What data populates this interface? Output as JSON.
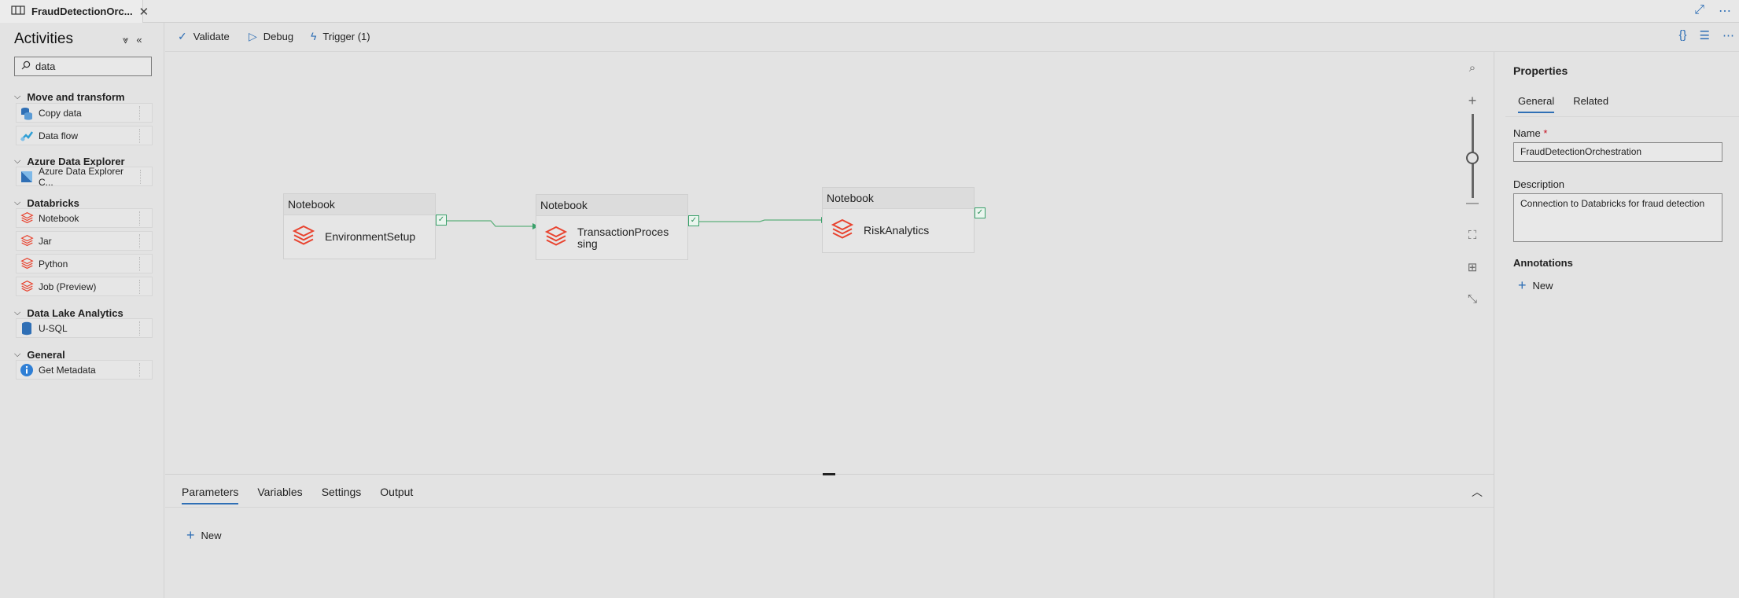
{
  "tab": {
    "title": "FraudDetectionOrc..."
  },
  "activities": {
    "header": "Activities",
    "search_value": "data",
    "categories": [
      {
        "label": "Move and transform",
        "items": [
          "Copy data",
          "Data flow"
        ]
      },
      {
        "label": "Azure Data Explorer",
        "items": [
          "Azure Data Explorer C..."
        ]
      },
      {
        "label": "Databricks",
        "items": [
          "Notebook",
          "Jar",
          "Python",
          "Job (Preview)"
        ]
      },
      {
        "label": "Data Lake Analytics",
        "items": [
          "U-SQL"
        ]
      },
      {
        "label": "General",
        "items": [
          "Get Metadata"
        ]
      }
    ]
  },
  "toolbar": {
    "validate": "Validate",
    "debug": "Debug",
    "trigger": "Trigger (1)"
  },
  "pipeline": {
    "nodes": [
      {
        "type": "Notebook",
        "name": "EnvironmentSetup"
      },
      {
        "type": "Notebook",
        "name": "TransactionProcessing"
      },
      {
        "type": "Notebook",
        "name": "RiskAnalytics"
      }
    ]
  },
  "bottom_panel": {
    "tabs": [
      "Parameters",
      "Variables",
      "Settings",
      "Output"
    ],
    "active_tab": "Parameters",
    "new_label": "New"
  },
  "properties": {
    "title": "Properties",
    "tabs": [
      "General",
      "Related"
    ],
    "name_label": "Name",
    "name_required": "*",
    "name_value": "FraudDetectionOrchestration",
    "description_label": "Description",
    "description_value": "Connection to Databricks for fraud detection",
    "annotations_label": "Annotations",
    "new_label": "New"
  },
  "colors": {
    "accent": "#2f6fb5",
    "databricks": "#e8432f",
    "success": "#3aa16b"
  }
}
